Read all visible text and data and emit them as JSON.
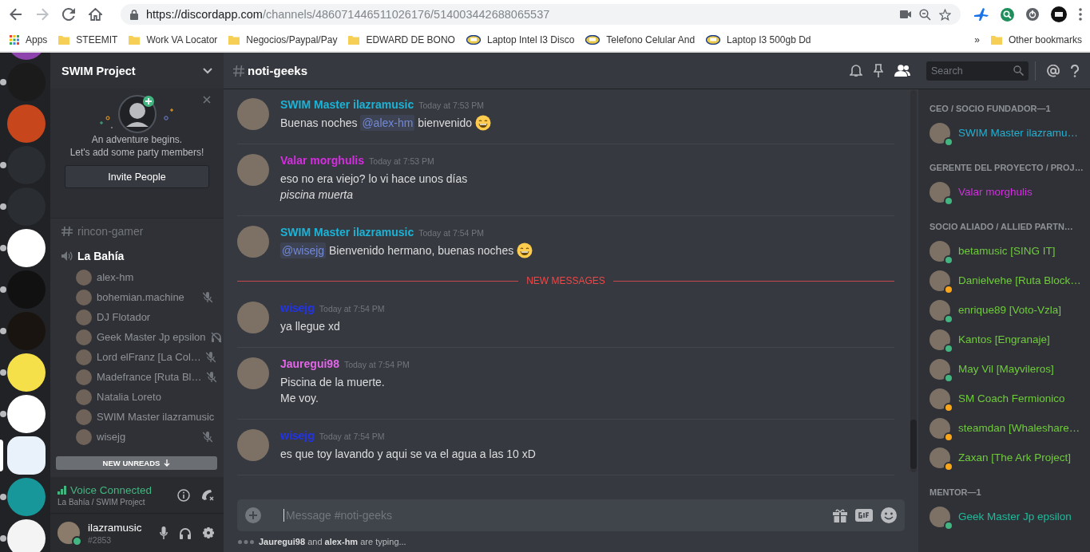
{
  "browser": {
    "url_host": "https://discordapp.com",
    "url_path": "/channels/486071446511026176/514003442688065537",
    "bookmarks": [
      {
        "kind": "apps",
        "label": "Apps"
      },
      {
        "kind": "folder",
        "label": "STEEMIT"
      },
      {
        "kind": "folder",
        "label": "Work VA Locator"
      },
      {
        "kind": "folder",
        "label": "Negocios/Paypal/Pay"
      },
      {
        "kind": "folder",
        "label": "EDWARD DE BONO"
      },
      {
        "kind": "page",
        "label": "Laptop Intel I3 Disco"
      },
      {
        "kind": "page",
        "label": "Telefono Celular And"
      },
      {
        "kind": "page",
        "label": "Laptop I3 500gb Dd"
      }
    ],
    "more": "»",
    "other": "Other bookmarks"
  },
  "servers": [
    {
      "color": "#8e44ad"
    },
    {
      "color": "#1b1b1b",
      "unread": true,
      "selected": false
    },
    {
      "color": "#c8461c",
      "unread": false,
      "selected": false
    },
    {
      "color": "#2a2d31",
      "unread": true,
      "selected": false
    },
    {
      "color": "#2a2d31",
      "unread": true,
      "selected": false
    },
    {
      "color": "#ffffff",
      "unread": true,
      "selected": false
    },
    {
      "color": "#111111",
      "unread": true,
      "selected": false
    },
    {
      "color": "#1a1410",
      "unread": true,
      "selected": false
    },
    {
      "color": "#f5e04a",
      "unread": true,
      "selected": false
    },
    {
      "color": "#ffffff",
      "unread": true,
      "selected": false
    },
    {
      "color": "#e9f1fb",
      "unread": false,
      "selected": true
    },
    {
      "color": "#17979a",
      "unread": true,
      "selected": false
    },
    {
      "color": "#f4f4f4",
      "unread": true,
      "selected": false
    }
  ],
  "server": {
    "name": "SWIM Project"
  },
  "invite": {
    "lines": [
      "An adventure begins.",
      "Let's add some party members!"
    ],
    "button": "Invite People"
  },
  "channels": [
    {
      "kind": "text",
      "name": "rincon-gamer"
    },
    {
      "kind": "voice",
      "name": "La Bahía",
      "users": [
        {
          "name": "alex-hm",
          "muted": false,
          "deafened": false
        },
        {
          "name": "bohemian.machine",
          "muted": true,
          "deafened": false
        },
        {
          "name": "DJ Flotador",
          "muted": false,
          "deafened": false
        },
        {
          "name": "Geek Master Jp epsilon",
          "muted": false,
          "deafened": true
        },
        {
          "name": "Lord elFranz [La Col…",
          "muted": true,
          "deafened": false
        },
        {
          "name": "Madefrance [Ruta Bl…",
          "muted": true,
          "deafened": false
        },
        {
          "name": "Natalia Loreto",
          "muted": false,
          "deafened": false
        },
        {
          "name": "SWIM Master ilazramusic",
          "muted": false,
          "deafened": false
        },
        {
          "name": "wisejg",
          "muted": true,
          "deafened": false
        }
      ]
    }
  ],
  "new_unreads": "NEW UNREADS",
  "voice": {
    "status": "Voice Connected",
    "location": "La Bahía / SWIM Project"
  },
  "user": {
    "name": "ilazramusic",
    "tag": "#2853",
    "idle": false
  },
  "channel": {
    "name": "noti-geeks"
  },
  "search": {
    "placeholder": "Search"
  },
  "messages": [
    {
      "kind": "group",
      "author": "SWIM Master ilazramusic",
      "color": "#1cb3d6",
      "time": "Today at 7:53 PM",
      "lines": [
        [
          {
            "kind": "text",
            "text": "Buenas noches "
          },
          {
            "kind": "mention",
            "text": "@alex-hm"
          },
          {
            "kind": "text",
            "text": " bienvenido"
          },
          {
            "kind": "emoji"
          }
        ]
      ]
    },
    {
      "kind": "group",
      "author": "Valar morghulis",
      "color": "#d42ee0",
      "time": "Today at 7:53 PM",
      "lines": [
        [
          {
            "kind": "text",
            "text": "eso no era viejo? lo vi hace unos días"
          }
        ],
        [
          {
            "kind": "italic",
            "text": "piscina muerta"
          }
        ]
      ]
    },
    {
      "kind": "group",
      "author": "SWIM Master ilazramusic",
      "color": "#1cb3d6",
      "time": "Today at 7:54 PM",
      "lines": [
        [
          {
            "kind": "mention",
            "text": "@wisejg"
          },
          {
            "kind": "text",
            "text": " Bienvenido hermano, buenas noches"
          },
          {
            "kind": "emoji"
          }
        ]
      ]
    },
    {
      "kind": "divider",
      "label": "NEW MESSAGES"
    },
    {
      "kind": "group",
      "author": "wisejg",
      "color": "#2233ee",
      "time": "Today at 7:54 PM",
      "lines": [
        [
          {
            "kind": "text",
            "text": "ya llegue xd"
          }
        ]
      ]
    },
    {
      "kind": "group",
      "author": "Jauregui98",
      "color": "#e266e8",
      "time": "Today at 7:54 PM",
      "lines": [
        [
          {
            "kind": "text",
            "text": "Piscina de la muerte."
          }
        ],
        [
          {
            "kind": "text",
            "text": "Me voy."
          }
        ]
      ]
    },
    {
      "kind": "group",
      "author": "wisejg",
      "color": "#2233ee",
      "time": "Today at 7:54 PM",
      "lines": [
        [
          {
            "kind": "text",
            "text": "es que toy lavando y aqui se va el agua a las 10 xD"
          }
        ]
      ]
    }
  ],
  "composer": {
    "placeholder": "Message #noti-geeks"
  },
  "typing": "**Jauregui98** and **alex-hm** are typing...",
  "member_groups": [
    {
      "title": "CEO / SOCIO FUNDADOR—1",
      "members": [
        {
          "name": "SWIM Master ilazramu…",
          "color": "#1cb3d6",
          "idle": false
        }
      ]
    },
    {
      "title": "GERENTE DEL PROYECTO / PROJ…",
      "members": [
        {
          "name": "Valar morghulis",
          "color": "#d42ee0",
          "idle": false
        }
      ]
    },
    {
      "title": "SOCIO ALIADO / ALLIED PARTN…",
      "members": [
        {
          "name": "betamusic [SING IT]",
          "color": "#6fcb3c",
          "idle": false
        },
        {
          "name": "Danielvehe [Ruta Block…",
          "color": "#6fcb3c",
          "idle": true
        },
        {
          "name": "enrique89 [Voto-Vzla]",
          "color": "#6fcb3c",
          "idle": false
        },
        {
          "name": "Kantos [Engranaje]",
          "color": "#6fcb3c",
          "idle": false
        },
        {
          "name": "May Vil [Mayvileros]",
          "color": "#6fcb3c",
          "idle": false
        },
        {
          "name": "SM Coach Fermionico",
          "color": "#6fcb3c",
          "idle": true
        },
        {
          "name": "steamdan [Whaleshare…",
          "color": "#6fcb3c",
          "idle": true
        },
        {
          "name": "Zaxan [The Ark Project]",
          "color": "#6fcb3c",
          "idle": true
        }
      ]
    },
    {
      "title": "MENTOR—1",
      "members": [
        {
          "name": "Geek Master Jp epsilon",
          "color": "#1abc9c",
          "idle": false
        }
      ]
    }
  ]
}
